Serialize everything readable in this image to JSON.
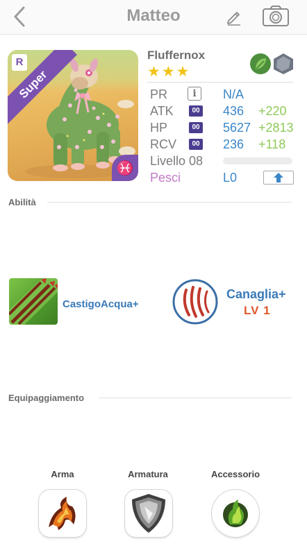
{
  "header": {
    "title": "Matteo",
    "back_icon": "chevron-left-icon",
    "edit_icon": "pencil-icon",
    "camera_icon": "camera-icon"
  },
  "monster": {
    "name": "Fluffernox",
    "rank_badge": "R",
    "tag": "Super",
    "stars": "★★★",
    "star_count": 3,
    "zodiac_sign": "♓",
    "elements": [
      "leaf-element-icon",
      "rock-element-icon"
    ]
  },
  "stats": {
    "pr": {
      "label": "PR",
      "value": "N/A"
    },
    "atk": {
      "label": "ATK",
      "badge": "00",
      "value": "436",
      "bonus": "+220"
    },
    "hp": {
      "label": "HP",
      "badge": "00",
      "value": "5627",
      "bonus": "+2813"
    },
    "rcv": {
      "label": "RCV",
      "badge": "00",
      "value": "236",
      "bonus": "+118"
    },
    "level": {
      "label": "Livello 08",
      "progress": 0
    },
    "zodiac": {
      "label": "Pesci",
      "value": "L0"
    }
  },
  "sections": {
    "abilities": "Abilità",
    "equipment": "Equipaggiamento"
  },
  "skill": {
    "name": "CastigoAcqua+"
  },
  "ability": {
    "name": "Canaglia+",
    "level": "LV 1"
  },
  "equipment": {
    "weapon": "Arma",
    "armor": "Armatura",
    "accessory": "Accessorio"
  },
  "colors": {
    "value_blue": "#3a87c8",
    "bonus_green": "#8fca5a",
    "zodiac_pink": "#c07ac7",
    "rank_purple": "#7b52b0",
    "level_orange": "#e0572a"
  }
}
